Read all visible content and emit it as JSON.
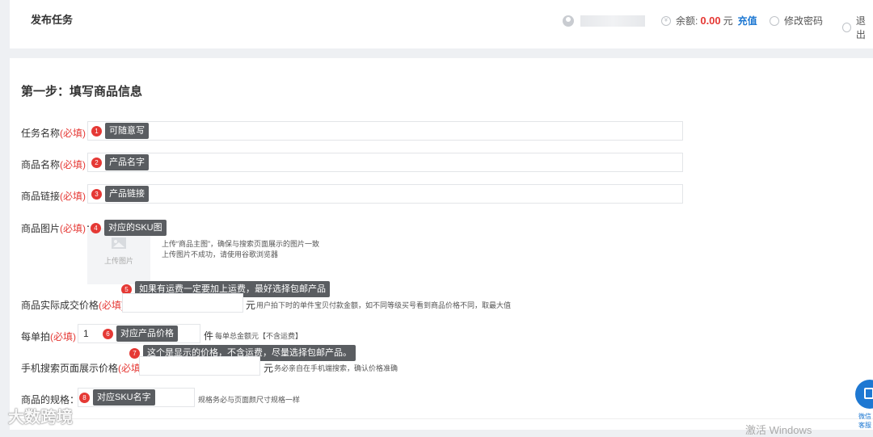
{
  "header": {
    "title": "发布任务",
    "balance_label": "余额:",
    "balance_value": "0.00",
    "balance_unit": "元",
    "recharge": "充值",
    "change_password": "修改密码",
    "logout": "退出"
  },
  "main": {
    "step_title": "第一步：填写商品信息",
    "required": "(必填)",
    "colon": "：",
    "fields": {
      "task_name": {
        "label": "任务名称",
        "tip_no": "1",
        "tip": "可随意写"
      },
      "product_name": {
        "label": "商品名称",
        "tip_no": "2",
        "tip": "产品名字"
      },
      "product_link": {
        "label": "商品链接",
        "tip_no": "3",
        "tip": "产品链接"
      },
      "product_image": {
        "label": "商品图片",
        "tip_no": "4",
        "tip": "对应的SKU图",
        "upload_label": "上传图片",
        "hint1": "上传“商品主图”，确保与搜索页面展示的图片一致",
        "hint2": "上传图片不成功，请使用谷歌浏览器"
      },
      "deal_price": {
        "label": "商品实际成交价格",
        "tip_no": "5",
        "tip": "如果有运费一定要加上运费，最好选择包邮产品",
        "unit": "元",
        "hint": "用户拍下时的单件宝贝付款金额，如不同等级买号看到商品价格不同，取最大值"
      },
      "per_order": {
        "label": "每单拍",
        "value": "1",
        "tip_no": "6",
        "tip": "对应产品价格",
        "unit": "件",
        "hint": "每单总金额元【不含运费】"
      },
      "mobile_price": {
        "label": "手机搜索页面展示价格",
        "tip_no": "7",
        "tip": "这个是显示的价格，不含运费，尽量选择包邮产品。",
        "unit": "元",
        "hint": "务必亲自在手机端搜索，确认价格准确"
      },
      "spec": {
        "label": "商品的规格",
        "tip_no": "8",
        "tip": "对应SKU名字",
        "hint": "规格务必与页面颜尺寸规格一样"
      }
    }
  },
  "side": {
    "label": "微信客服"
  },
  "watermark": "大数跨境",
  "os_notice": "激活 Windows",
  "colors": {
    "required": "#e53935",
    "accent": "#1e78d2",
    "tooltip": "#5a5d61"
  },
  "icons": [
    "user-icon",
    "coin-icon",
    "lock-icon",
    "power-icon",
    "image-icon",
    "qr-icon"
  ]
}
